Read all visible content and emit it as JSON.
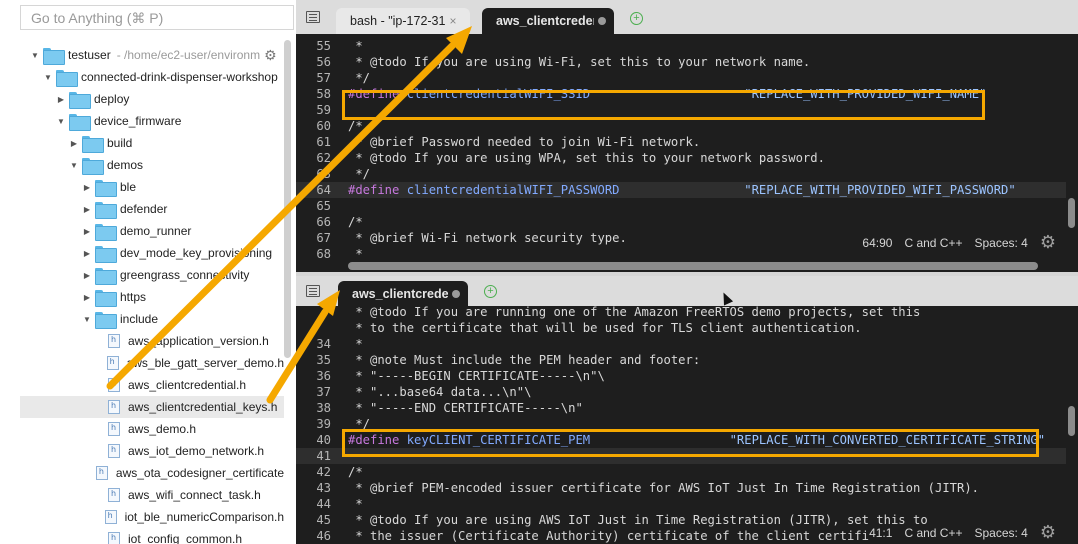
{
  "sidebar": {
    "search_placeholder": "Go to Anything (⌘ P)",
    "tree": [
      {
        "label": "testuser",
        "path": "- /home/ec2-user/environm",
        "indent": 0,
        "type": "folder",
        "expanded": true,
        "gear": true
      },
      {
        "label": "connected-drink-dispenser-workshop",
        "indent": 1,
        "type": "folder",
        "expanded": true
      },
      {
        "label": "deploy",
        "indent": 2,
        "type": "folder",
        "expanded": false
      },
      {
        "label": "device_firmware",
        "indent": 2,
        "type": "folder",
        "expanded": true
      },
      {
        "label": "build",
        "indent": 3,
        "type": "folder",
        "expanded": false
      },
      {
        "label": "demos",
        "indent": 3,
        "type": "folder",
        "expanded": true
      },
      {
        "label": "ble",
        "indent": 4,
        "type": "folder",
        "expanded": false
      },
      {
        "label": "defender",
        "indent": 4,
        "type": "folder",
        "expanded": false
      },
      {
        "label": "demo_runner",
        "indent": 4,
        "type": "folder",
        "expanded": false
      },
      {
        "label": "dev_mode_key_provisioning",
        "indent": 4,
        "type": "folder",
        "expanded": false
      },
      {
        "label": "greengrass_connectivity",
        "indent": 4,
        "type": "folder",
        "expanded": false
      },
      {
        "label": "https",
        "indent": 4,
        "type": "folder",
        "expanded": false
      },
      {
        "label": "include",
        "indent": 4,
        "type": "folder",
        "expanded": true
      },
      {
        "label": "aws_application_version.h",
        "indent": 5,
        "type": "file"
      },
      {
        "label": "aws_ble_gatt_server_demo.h",
        "indent": 5,
        "type": "file"
      },
      {
        "label": "aws_clientcredential.h",
        "indent": 5,
        "type": "file"
      },
      {
        "label": "aws_clientcredential_keys.h",
        "indent": 5,
        "type": "file",
        "selected": true
      },
      {
        "label": "aws_demo.h",
        "indent": 5,
        "type": "file"
      },
      {
        "label": "aws_iot_demo_network.h",
        "indent": 5,
        "type": "file"
      },
      {
        "label": "aws_ota_codesigner_certificate",
        "indent": 5,
        "type": "file"
      },
      {
        "label": "aws_wifi_connect_task.h",
        "indent": 5,
        "type": "file"
      },
      {
        "label": "iot_ble_numericComparison.h",
        "indent": 5,
        "type": "file"
      },
      {
        "label": "iot_config_common.h",
        "indent": 5,
        "type": "file"
      }
    ]
  },
  "top_pane": {
    "tabs": [
      {
        "label": "bash - \"ip-172-31",
        "active": false,
        "close": "×"
      },
      {
        "label": "aws_clientcreder",
        "active": true,
        "modified": true
      }
    ],
    "lines": [
      {
        "n": "55",
        "t": " * "
      },
      {
        "n": "56",
        "t": " * @todo If you are using Wi-Fi, set this to your network name."
      },
      {
        "n": "57",
        "t": " */"
      },
      {
        "n": "58",
        "kw": "#define",
        "mac": " clientcredentialWIFI_SSID",
        "pad": "                     ",
        "str": "\"REPLACE_WITH_PROVIDED_WIFI_NAME\""
      },
      {
        "n": "59",
        "t": ""
      },
      {
        "n": "60",
        "t": "/*"
      },
      {
        "n": "61",
        "t": " * @brief Password needed to join Wi-Fi network."
      },
      {
        "n": "62",
        "t": " * @todo If you are using WPA, set this to your network password."
      },
      {
        "n": "63",
        "t": " */"
      },
      {
        "n": "64",
        "kw": "#define",
        "mac": " clientcredentialWIFI_PASSWORD",
        "pad": "                 ",
        "str": "\"REPLACE_WITH_PROVIDED_WIFI_PASSWORD\"",
        "hl": true
      },
      {
        "n": "65",
        "t": ""
      },
      {
        "n": "66",
        "t": "/*"
      },
      {
        "n": "67",
        "t": " * @brief Wi-Fi network security type."
      },
      {
        "n": "68",
        "t": " *"
      }
    ],
    "status": {
      "position": "64:90",
      "language": "C and C++",
      "spaces": "Spaces: 4"
    }
  },
  "bottom_pane": {
    "tabs": [
      {
        "label": "aws_clientcreder",
        "active": true,
        "modified": true
      }
    ],
    "lines": [
      {
        "n": "",
        "t": " * @todo If you are running one of the Amazon FreeRTOS demo projects, set this"
      },
      {
        "n": "",
        "t": " * to the certificate that will be used for TLS client authentication."
      },
      {
        "n": "34",
        "t": " *"
      },
      {
        "n": "35",
        "t": " * @note Must include the PEM header and footer:"
      },
      {
        "n": "36",
        "t": " * \"-----BEGIN CERTIFICATE-----\\n\"\\"
      },
      {
        "n": "37",
        "t": " * \"...base64 data...\\n\"\\"
      },
      {
        "n": "38",
        "t": " * \"-----END CERTIFICATE-----\\n\""
      },
      {
        "n": "39",
        "t": " */"
      },
      {
        "n": "40",
        "kw": "#define",
        "mac": " keyCLIENT_CERTIFICATE_PEM",
        "pad": "                   ",
        "str": "\"REPLACE_WITH_CONVERTED_CERTIFICATE_STRING\""
      },
      {
        "n": "41",
        "t": "",
        "hl": true
      },
      {
        "n": "42",
        "t": "/*"
      },
      {
        "n": "43",
        "t": " * @brief PEM-encoded issuer certificate for AWS IoT Just In Time Registration (JITR)."
      },
      {
        "n": "44",
        "t": " *"
      },
      {
        "n": "45",
        "t": " * @todo If you are using AWS IoT Just in Time Registration (JITR), set this to"
      },
      {
        "n": "46",
        "t": " * the issuer (Certificate Authority) certificate of the client certifi"
      }
    ],
    "status": {
      "position": "41:1",
      "language": "C and C++",
      "spaces": "Spaces: 4"
    }
  },
  "colors": {
    "highlight_box": "#f5a800",
    "arrow": "#f5a800",
    "editor_bg": "#1e1e1e"
  }
}
